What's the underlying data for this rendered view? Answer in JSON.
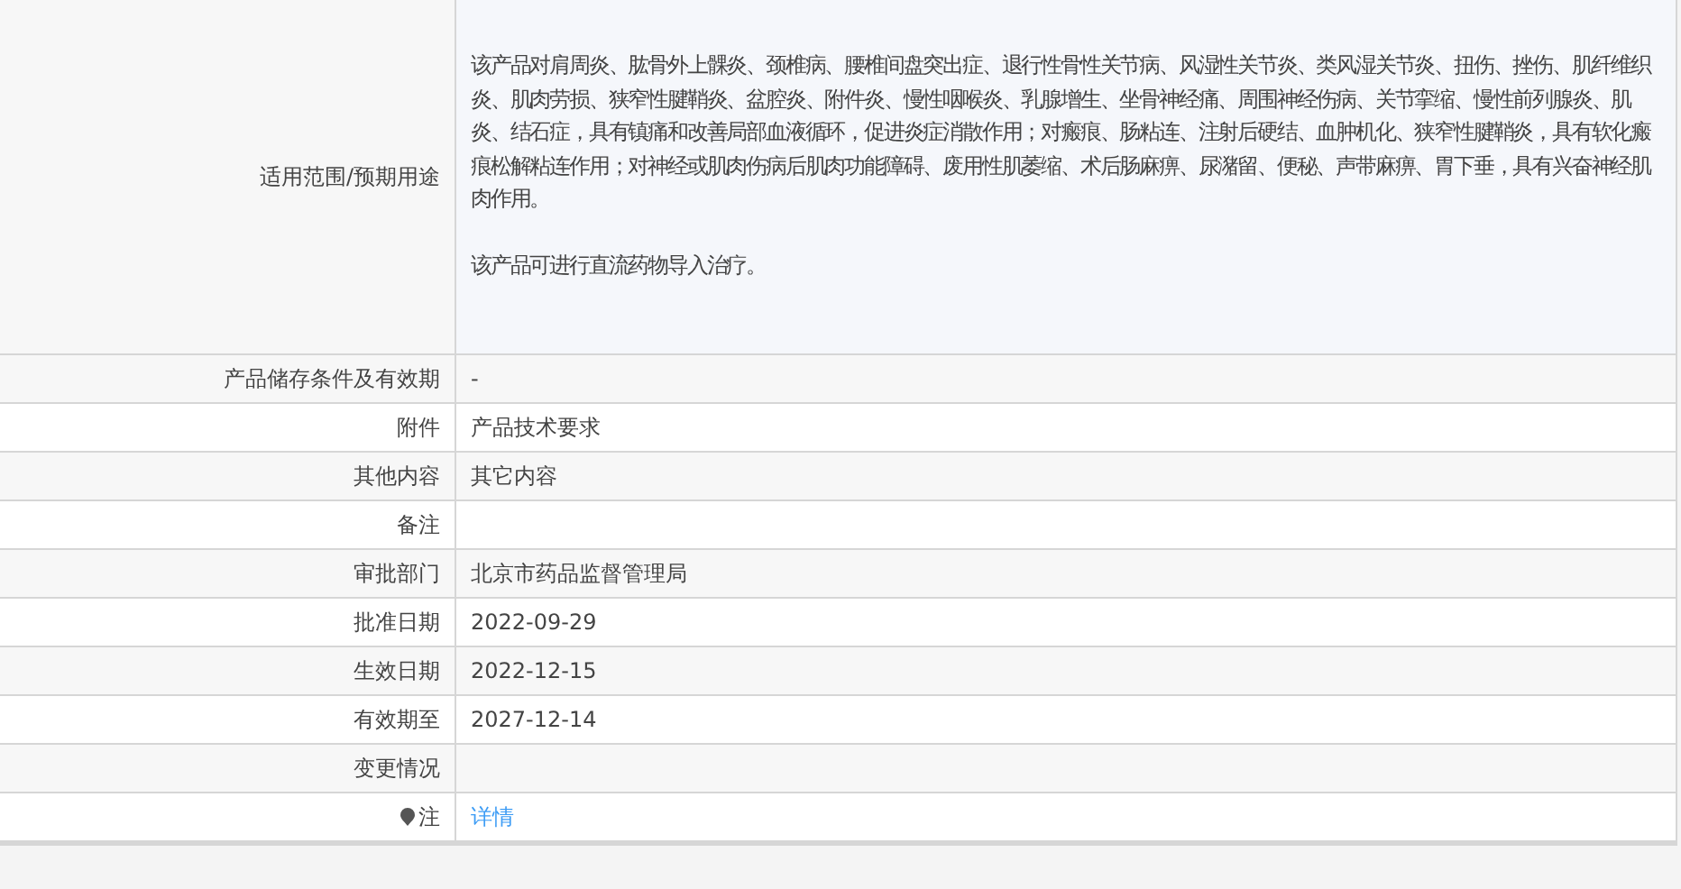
{
  "rows": [
    {
      "label": "适用范围/预期用途",
      "kind": "paragraphs",
      "paragraphs": [
        "该产品对肩周炎、肱骨外上髁炎、颈椎病、腰椎间盘突出症、退行性骨性关节病、风湿性关节炎、类风湿关节炎、扭伤、挫伤、肌纤维织炎、肌肉劳损、狭窄性腱鞘炎、盆腔炎、附件炎、慢性咽喉炎、乳腺增生、坐骨神经痛、周围神经伤病、关节挛缩、慢性前列腺炎、肌炎、结石症，具有镇痛和改善局部血液循环，促进炎症消散作用；对瘢痕、肠粘连、注射后硬结、血肿机化、狭窄性腱鞘炎，具有软化瘢痕松解粘连作用；对神经或肌肉伤病后肌肉功能障碍、废用性肌萎缩、术后肠麻痹、尿潴留、便秘、声带麻痹、胃下垂，具有兴奋神经肌肉作用。",
        "该产品可进行直流药物导入治疗。"
      ]
    },
    {
      "label": "产品储存条件及有效期",
      "kind": "text",
      "value": "-"
    },
    {
      "label": "附件",
      "kind": "text",
      "value": "产品技术要求"
    },
    {
      "label": "其他内容",
      "kind": "text",
      "value": "其它内容"
    },
    {
      "label": "备注",
      "kind": "text"
    },
    {
      "label": "审批部门",
      "kind": "text",
      "value": "北京市药品监督管理局"
    },
    {
      "label": "批准日期",
      "kind": "text",
      "value": "2022-09-29"
    },
    {
      "label": "生效日期",
      "kind": "text",
      "value": "2022-12-15"
    },
    {
      "label": "有效期至",
      "kind": "text",
      "value": "2027-12-14"
    },
    {
      "label": "变更情况",
      "kind": "text"
    },
    {
      "label": "注",
      "kind": "link",
      "pinned": true,
      "value": "详情"
    }
  ]
}
